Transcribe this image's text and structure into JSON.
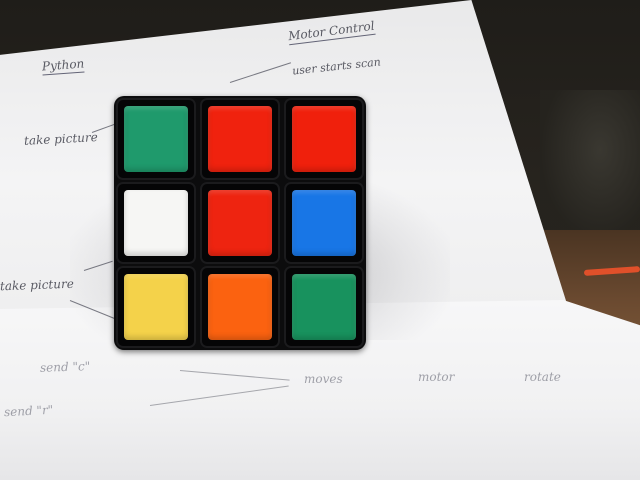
{
  "paper": {
    "notes": [
      {
        "text": "Python"
      },
      {
        "text": "Motor Control"
      },
      {
        "text": "user starts scan"
      },
      {
        "text": "take picture"
      },
      {
        "text": "take picture"
      },
      {
        "text": "send \"c\""
      },
      {
        "text": "send \"r\""
      },
      {
        "text": "moves"
      },
      {
        "text": "motor"
      },
      {
        "text": "rotate"
      }
    ]
  },
  "cube": {
    "face": [
      [
        {
          "color_name": "green",
          "hex": "#1f9a6c"
        },
        {
          "color_name": "red",
          "hex": "#f0220e"
        },
        {
          "color_name": "red",
          "hex": "#f0200c"
        }
      ],
      [
        {
          "color_name": "white",
          "hex": "#f6f6f4"
        },
        {
          "color_name": "red",
          "hex": "#ee2410"
        },
        {
          "color_name": "blue",
          "hex": "#1876e6"
        }
      ],
      [
        {
          "color_name": "yellow",
          "hex": "#f4d24a"
        },
        {
          "color_name": "orange",
          "hex": "#fb6210"
        },
        {
          "color_name": "green",
          "hex": "#18925e"
        }
      ]
    ]
  },
  "colors": {
    "paper": "#f2f2f3",
    "cube_body": "#0c0c0d",
    "ink": "#4a4b55"
  }
}
